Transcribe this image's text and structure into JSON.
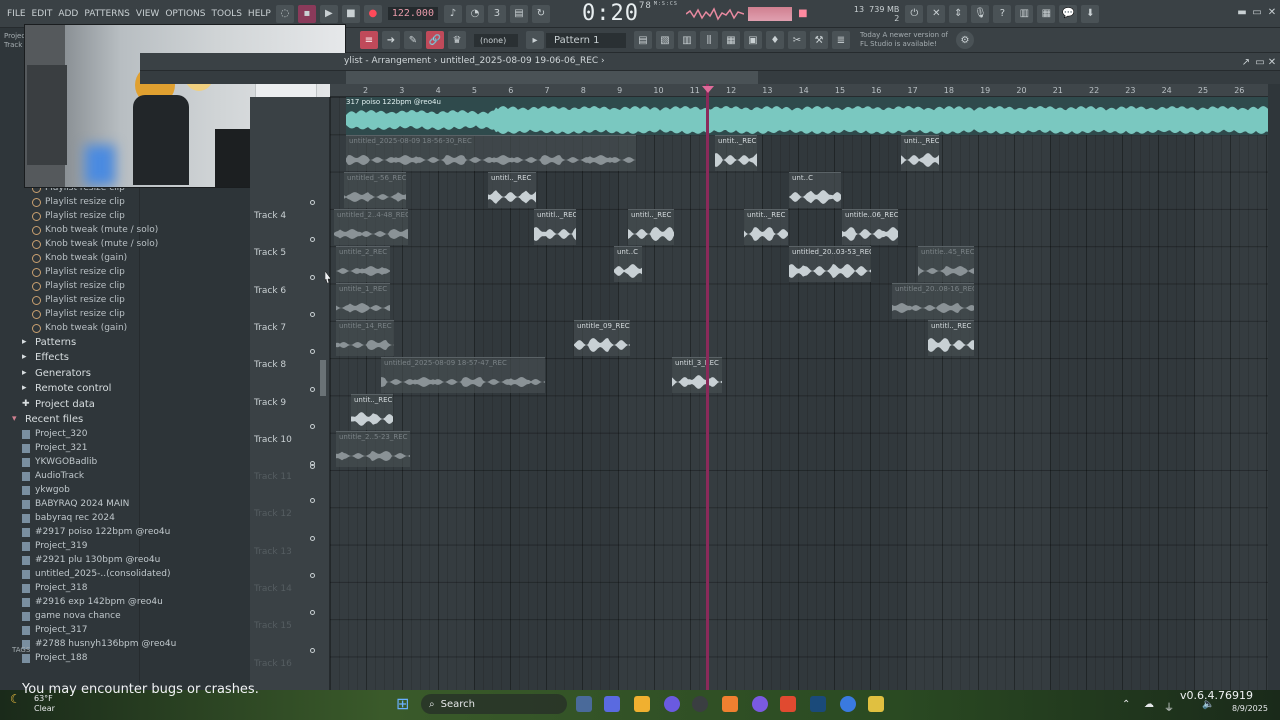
{
  "menu": [
    "FILE",
    "EDIT",
    "ADD",
    "PATTERNS",
    "VIEW",
    "OPTIONS",
    "TOOLS",
    "HELP"
  ],
  "transport": {
    "bpm": "122.000",
    "time_main": "0:20",
    "time_sub": "78",
    "time_unit": "M:S:CS",
    "memory": "739 MB",
    "memory_sub": "2",
    "cpu": "13"
  },
  "toolbar2": {
    "snap": "(none)",
    "pattern": "Pattern 1",
    "news_line1": "Today   A newer version of",
    "news_line2": "FL Studio is available!"
  },
  "browser": {
    "label_line1": "Projec",
    "label_line2": "Track",
    "history": [
      "Playlist resize clip",
      "Playlist resize clip",
      "Playlist resize clip",
      "Knob tweak (mute / solo)",
      "Knob tweak (mute / solo)",
      "Knob tweak (gain)",
      "Playlist resize clip",
      "Playlist resize clip",
      "Playlist resize clip",
      "Playlist resize clip",
      "Knob tweak (gain)"
    ],
    "folders": [
      "Patterns",
      "Effects",
      "Generators",
      "Remote control",
      "Project data"
    ],
    "recent_label": "Recent files",
    "recent": [
      "Project_320",
      "Project_321",
      "YKWGOBadlib",
      "AudioTrack",
      "ykwgob",
      "BABYRAQ 2024 MAIN",
      "babyraq rec 2024",
      "#2917 poiso 122bpm @reo4u",
      "Project_319",
      "#2921 plu 130bpm @reo4u",
      "untitled_2025-..(consolidated)",
      "Project_318",
      "#2916 exp 142bpm @reo4u",
      "game nova chance",
      "Project_317",
      "#2788 husnyh136bpm @reo4u",
      "Project_188"
    ],
    "tags": "TAGS"
  },
  "playlist": {
    "title": "ylist - Arrangement  ›  untitled_2025-08-09 19-06-06_REC  ›",
    "bars": [
      "2",
      "3",
      "4",
      "5",
      "6",
      "7",
      "8",
      "9",
      "10",
      "11",
      "12",
      "13",
      "14",
      "15",
      "16",
      "17",
      "18",
      "19",
      "20",
      "21",
      "22",
      "23",
      "24",
      "25",
      "26"
    ],
    "master_clip": "317 poiso 122bpm @reo4u",
    "tracks": [
      "Track 4",
      "Track 5",
      "Track 6",
      "Track 7",
      "Track 8",
      "Track 9",
      "Track 10",
      "Track 11",
      "Track 12",
      "Track 13",
      "Track 14",
      "Track 15",
      "Track 16"
    ],
    "clips": [
      {
        "name": "untitled_2025-08-09 18-56-30_REC",
        "dim": true
      },
      {
        "name": "untit.._REC",
        "dim": false
      },
      {
        "name": "unti.._REC",
        "dim": false
      },
      {
        "name": "untitled_-56_REC",
        "dim": true
      },
      {
        "name": "untitl.._REC",
        "dim": false
      },
      {
        "name": "unt..C",
        "dim": false
      },
      {
        "name": "untitled_2..4-48_REC",
        "dim": true
      },
      {
        "name": "untitl.._REC",
        "dim": false
      },
      {
        "name": "untitl.._REC",
        "dim": false
      },
      {
        "name": "untit.._REC",
        "dim": false
      },
      {
        "name": "untitle..06_REC",
        "dim": false
      },
      {
        "name": "untitle_2_REC",
        "dim": true
      },
      {
        "name": "unt..C",
        "dim": false
      },
      {
        "name": "untitled_20..03-53_REC",
        "dim": false
      },
      {
        "name": "untitle..45_REC",
        "dim": true
      },
      {
        "name": "untitle_1_REC",
        "dim": true
      },
      {
        "name": "untitled_20..08-16_REC",
        "dim": true
      },
      {
        "name": "untitle_14_REC",
        "dim": true
      },
      {
        "name": "untitle_09_REC",
        "dim": false
      },
      {
        "name": "untitl.._REC",
        "dim": false
      },
      {
        "name": "untitled_2025-08-09 18-57-47_REC",
        "dim": true
      },
      {
        "name": "untitl_3_REC",
        "dim": false
      },
      {
        "name": "untit.._REC",
        "dim": false
      },
      {
        "name": "untitle_2..5-23_REC",
        "dim": true
      }
    ]
  },
  "taskbar": {
    "warning": "You may encounter bugs or crashes.",
    "weather_temp": "63°F",
    "weather_text": "Clear",
    "search": "Search",
    "version": "v0.6.4.76919",
    "date": "8/9/2025"
  }
}
